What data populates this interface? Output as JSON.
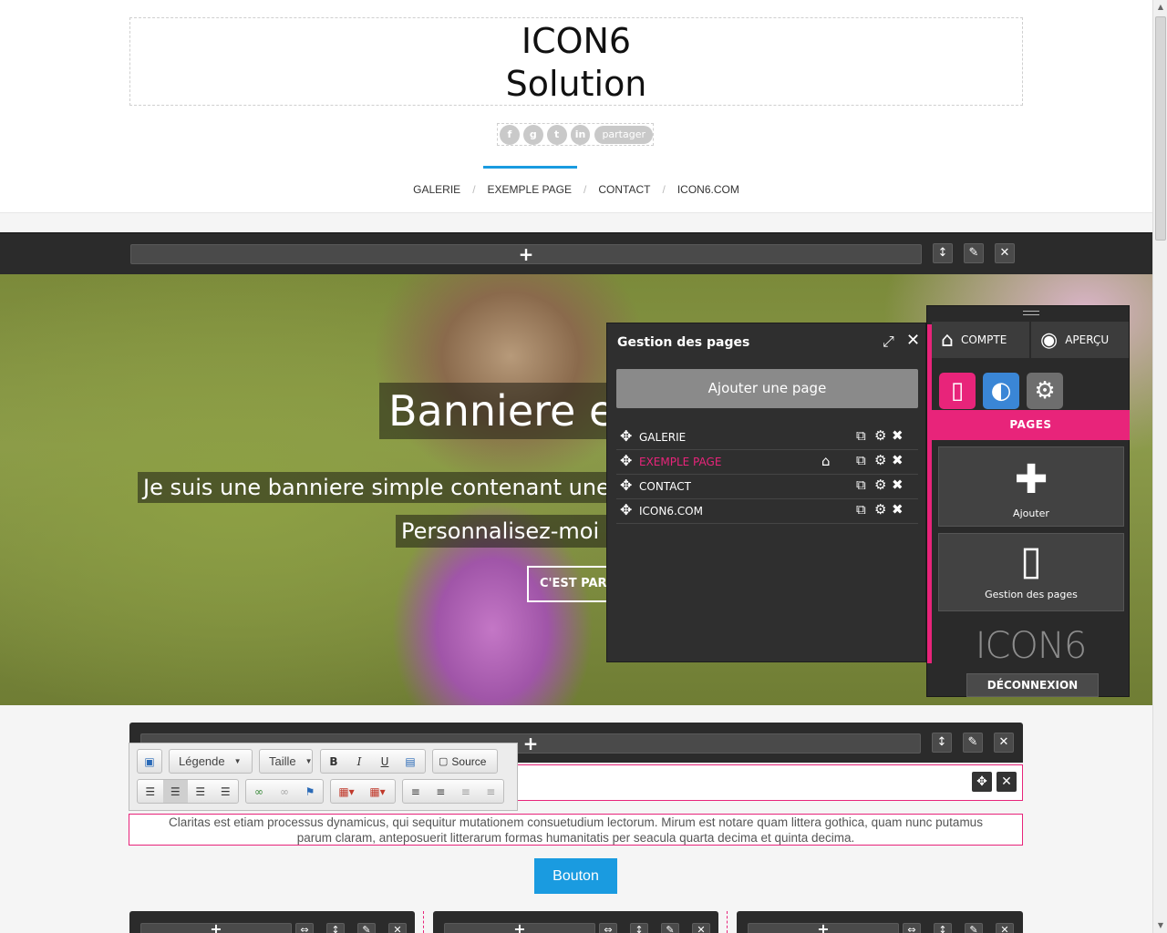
{
  "header": {
    "logo_line1": "ICON6",
    "logo_line2": "Solution",
    "share": {
      "icons": [
        "f",
        "g",
        "t",
        "in"
      ],
      "label": "partager"
    },
    "nav": [
      {
        "label": "GALERIE"
      },
      {
        "label": "EXEMPLE PAGE"
      },
      {
        "label": "CONTACT"
      },
      {
        "label": "ICON6.COM"
      }
    ],
    "nav_separator": "/"
  },
  "section_toolbar": {
    "add": "+",
    "move": "↕",
    "edit": "✎",
    "delete": "✕"
  },
  "banner": {
    "title": "Banniere e",
    "subtitle1": "Je suis une banniere simple contenant une i",
    "subtitle2": "Personnalisez-moi e",
    "button": "C'EST PART"
  },
  "pages_manager": {
    "title": "Gestion des pages",
    "add_button": "Ajouter une page",
    "pages": [
      {
        "label": "GALERIE",
        "active": false,
        "home": false
      },
      {
        "label": "EXEMPLE PAGE",
        "active": true,
        "home": true
      },
      {
        "label": "CONTACT",
        "active": false,
        "home": false
      },
      {
        "label": "ICON6.COM",
        "active": false,
        "home": false
      }
    ]
  },
  "control_panel": {
    "account_label": "COMPTE",
    "preview_label": "APERÇU",
    "pages_header": "PAGES",
    "add_card": "Ajouter",
    "pages_card": "Gestion des pages",
    "brand": "ICON6",
    "logout": "DÉCONNEXION",
    "colors": {
      "accent": "#e8247a",
      "design_tab": "#3a86d6"
    }
  },
  "editor": {
    "style_combo": "Légende",
    "size_combo": "Taille",
    "bold": "B",
    "italic": "I",
    "underline": "U",
    "source": "Source"
  },
  "content": {
    "paragraph_line1": "Claritas est etiam processus dynamicus, qui sequitur mutationem consuetudium lectorum. Mirum est notare quam littera gothica, quam nunc putamus",
    "paragraph_line2": "parum claram, anteposuerit litterarum formas humanitatis per seacula quarta decima et quinta decima.",
    "button": "Bouton"
  },
  "colors": {
    "brand_blue": "#1a9be0",
    "accent_pink": "#e8247a",
    "toolbar_dark": "#2b2b2b"
  }
}
